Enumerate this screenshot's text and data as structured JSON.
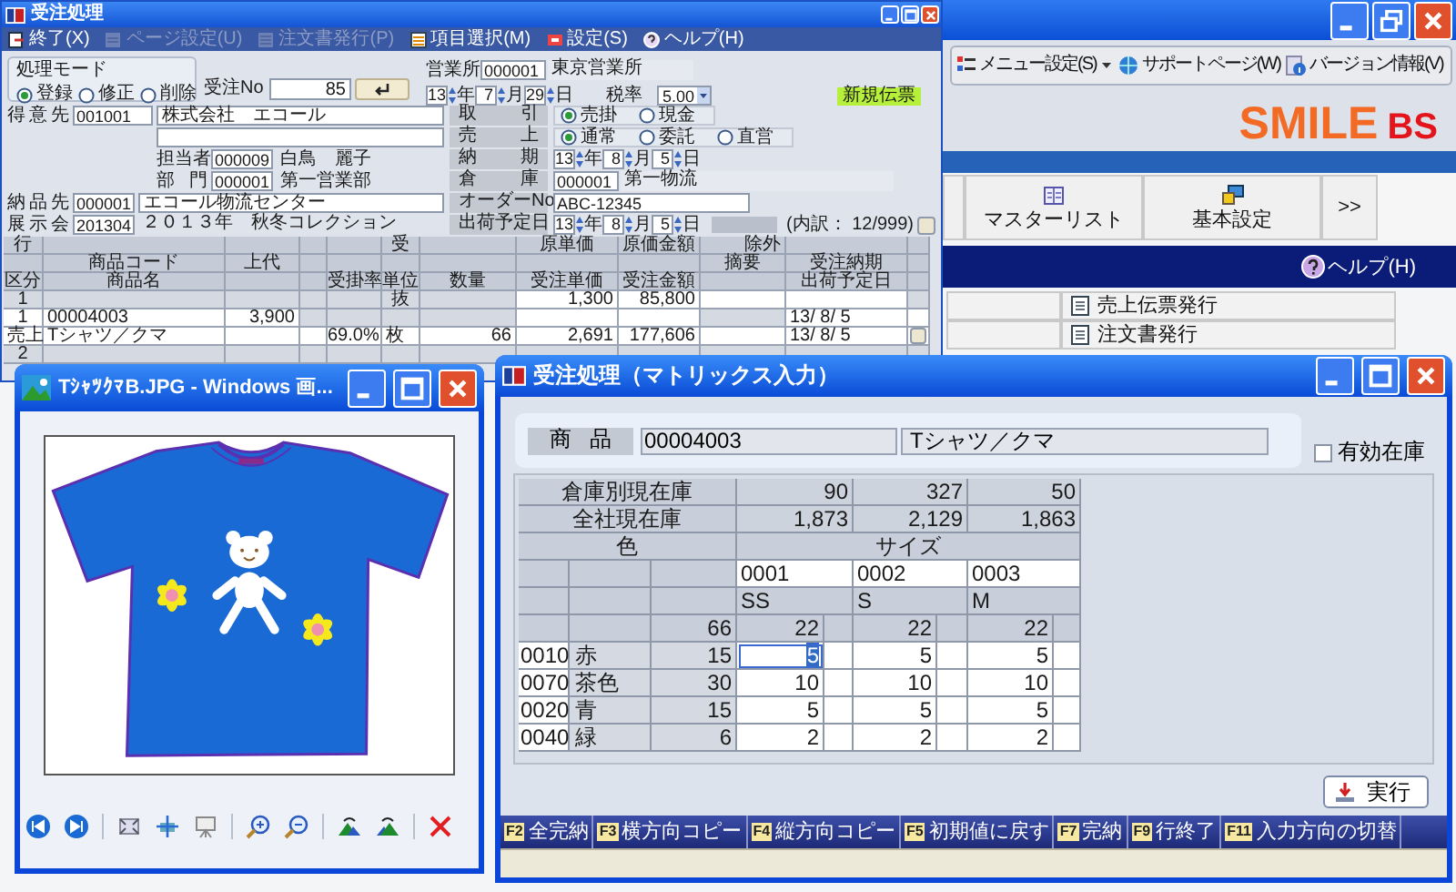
{
  "app": {
    "toolbar": [
      {
        "kind": "menu",
        "label": "メニュー設定(S)",
        "has_menu": true
      },
      {
        "kind": "support",
        "label": "サポートページ(W)",
        "has_menu": false
      },
      {
        "kind": "info",
        "label": "バージョン情報(V)",
        "has_menu": false
      }
    ],
    "logo": {
      "name": "SMILE",
      "suffix": "BS"
    },
    "nav_buttons": [
      {
        "kind": "list",
        "label": "マスターリスト"
      },
      {
        "kind": "settings",
        "label": "基本設定"
      },
      {
        "kind": "more",
        "label": ">>"
      }
    ],
    "help": "ヘルプ(H)",
    "menu_items": [
      "売上伝票発行",
      "注文書発行"
    ]
  },
  "order_window": {
    "title": "受注処理",
    "menu": [
      {
        "kind": "exit",
        "label": "終了(X)",
        "disabled": false
      },
      {
        "kind": "page",
        "label": "ページ設定(U)",
        "disabled": true
      },
      {
        "kind": "document",
        "label": "注文書発行(P)",
        "disabled": true
      },
      {
        "kind": "list",
        "label": "項目選択(M)",
        "disabled": false
      },
      {
        "kind": "settings",
        "label": "設定(S)",
        "disabled": false
      },
      {
        "kind": "help",
        "label": "ヘルプ(H)",
        "disabled": false
      }
    ],
    "mode": {
      "label": "処理モード",
      "options": [
        {
          "label": "登録",
          "selected": true
        },
        {
          "label": "修正",
          "selected": false
        },
        {
          "label": "削除",
          "selected": false
        }
      ]
    },
    "order_no": {
      "label": "受注No",
      "value": "85"
    },
    "office": {
      "label": "営業所",
      "code": "000001",
      "name": "東京営業所"
    },
    "order_date": [
      {
        "value": "13",
        "unit": "年"
      },
      {
        "value": "7",
        "unit": "月"
      },
      {
        "value": "29",
        "unit": "日"
      }
    ],
    "tax": {
      "label": "税率",
      "value": "5.00"
    },
    "badge": "新規伝票",
    "left_rows": [
      {
        "kind": "wide",
        "label": "得意先",
        "code": "001001",
        "name": "株式会社　エコール"
      },
      {
        "kind": "blank"
      },
      {
        "kind": "sub",
        "label": "担当者",
        "code": "000009",
        "name": "白鳥　麗子"
      },
      {
        "kind": "sub",
        "label": "部門",
        "code": "000001",
        "name": "第一営業部"
      },
      {
        "kind": "narrow",
        "label": "納品先",
        "code": "000001",
        "name": "エコール物流センター",
        "name_box": true
      },
      {
        "kind": "narrow",
        "label": "展示会",
        "code": "201304",
        "name": "２０１３年　秋冬コレクション",
        "name_box": false
      }
    ],
    "right_rows": [
      {
        "kind": "radio",
        "label": "取引",
        "options": [
          {
            "label": "売掛",
            "selected": true
          },
          {
            "label": "現金",
            "selected": false
          }
        ]
      },
      {
        "kind": "radio",
        "label": "売上",
        "options": [
          {
            "label": "通常",
            "selected": true
          },
          {
            "label": "委託",
            "selected": false
          },
          {
            "label": "直営",
            "selected": false
          }
        ]
      },
      {
        "kind": "date",
        "label": "納期",
        "parts": [
          {
            "value": "13",
            "unit": "年"
          },
          {
            "value": "8",
            "unit": "月"
          },
          {
            "value": "5",
            "unit": "日"
          }
        ]
      },
      {
        "kind": "code",
        "label": "倉庫",
        "code": "000001",
        "name": "第一物流"
      },
      {
        "kind": "text",
        "label": "オーダーNo",
        "value": "ABC-12345"
      },
      {
        "kind": "date",
        "label": "出荷予定日",
        "parts": [
          {
            "value": "13",
            "unit": "年"
          },
          {
            "value": "8",
            "unit": "月"
          },
          {
            "value": "5",
            "unit": "日"
          }
        ],
        "summary": "(内訳： 12/999)"
      }
    ],
    "grid": {
      "header": [
        [
          {
            "text": "行",
            "kind": "head"
          },
          {
            "kind": "head"
          },
          {
            "kind": "head"
          },
          {
            "kind": "head"
          },
          {
            "kind": "head"
          },
          {
            "text": "受",
            "kind": "head"
          },
          {
            "kind": "head"
          },
          {
            "text": "原単価",
            "kind": "head"
          },
          {
            "text": "原価金額",
            "kind": "head"
          },
          {
            "text": "除外",
            "kind": "head_right"
          },
          {
            "kind": "head"
          },
          {
            "kind": "head"
          }
        ],
        [
          {
            "kind": "head"
          },
          {
            "text": "商品コード",
            "kind": "head"
          },
          {
            "text": "上代",
            "kind": "head"
          },
          {
            "kind": "head"
          },
          {
            "kind": "head"
          },
          {
            "kind": "head"
          },
          {
            "kind": "head"
          },
          {
            "kind": "head"
          },
          {
            "kind": "head"
          },
          {
            "text": "摘要",
            "kind": "head"
          },
          {
            "text": "受注納期",
            "kind": "head"
          },
          {
            "kind": "head"
          }
        ],
        [
          {
            "text": "区分",
            "kind": "head"
          },
          {
            "text": "商品名",
            "kind": "head"
          },
          {
            "kind": "head"
          },
          {
            "kind": "head"
          },
          {
            "text": "受掛率",
            "kind": "head"
          },
          {
            "text": "単位",
            "kind": "head"
          },
          {
            "text": "数量",
            "kind": "head"
          },
          {
            "text": "受注単価",
            "kind": "head"
          },
          {
            "text": "受注金額",
            "kind": "head"
          },
          {
            "kind": "head"
          },
          {
            "text": "出荷予定日",
            "kind": "head"
          },
          {
            "kind": "head"
          }
        ]
      ],
      "rows": [
        [
          {
            "text": "1",
            "kind": "index"
          },
          {
            "kind": "gray"
          },
          {
            "kind": "gray"
          },
          {
            "kind": "gray"
          },
          {
            "kind": "gray"
          },
          {
            "text": "抜",
            "kind": "gray"
          },
          {
            "kind": "gray"
          },
          {
            "text": "1,300",
            "kind": "num"
          },
          {
            "text": "85,800",
            "kind": "num"
          },
          {
            "kind": "input"
          },
          {
            "kind": "input"
          },
          {
            "kind": "gray"
          }
        ],
        [
          {
            "text": "1",
            "kind": "index_input"
          },
          {
            "text": "00004003",
            "kind": "input"
          },
          {
            "text": "3,900",
            "kind": "num"
          },
          {
            "kind": "gray"
          },
          {
            "kind": "gray"
          },
          {
            "kind": "gray"
          },
          {
            "kind": "gray"
          },
          {
            "kind": "input"
          },
          {
            "kind": "input"
          },
          {
            "kind": "gray"
          },
          {
            "text": "13/ 8/ 5",
            "kind": "input"
          },
          {
            "kind": "input"
          }
        ],
        [
          {
            "text": "売上",
            "kind": "input"
          },
          {
            "text": "Tシャツ／クマ",
            "kind": "input"
          },
          {
            "kind": "input"
          },
          {
            "kind": "input"
          },
          {
            "text": "69.0%",
            "kind": "num"
          },
          {
            "text": "枚",
            "kind": "input"
          },
          {
            "text": "66",
            "kind": "num"
          },
          {
            "text": "2,691",
            "kind": "num"
          },
          {
            "text": "177,606",
            "kind": "num"
          },
          {
            "kind": "input"
          },
          {
            "text": "13/ 8/ 5",
            "kind": "input"
          },
          {
            "kind": "button"
          }
        ],
        [
          {
            "text": "2",
            "kind": "index"
          },
          {
            "kind": "gray"
          },
          {
            "kind": "gray"
          },
          {
            "kind": "gray"
          },
          {
            "kind": "gray"
          },
          {
            "kind": "gray"
          },
          {
            "kind": "gray"
          },
          {
            "kind": "gray"
          },
          {
            "kind": "gray"
          },
          {
            "kind": "gray"
          },
          {
            "kind": "gray"
          },
          {
            "kind": "gray"
          }
        ]
      ]
    }
  },
  "image_viewer": {
    "title": "TｼｬﾂｸﾏB.JPG - Windows 画..."
  },
  "matrix_window": {
    "title": "受注処理（マトリックス入力）",
    "product": {
      "label": "商品",
      "code": "00004003",
      "name": "Tシャツ／クマ"
    },
    "stock_option": {
      "label": "有効在庫",
      "checked": false
    },
    "table": {
      "stock_rows": [
        {
          "label": "倉庫別現在庫",
          "values": [
            "90",
            "327",
            "50"
          ]
        },
        {
          "label": "全社現在庫",
          "values": [
            "1,873",
            "2,129",
            "1,863"
          ]
        }
      ],
      "color_header": "色",
      "size_header": "サイズ",
      "total": "66",
      "sizes": [
        {
          "code": "0001",
          "name": "SS",
          "total": "22"
        },
        {
          "code": "0002",
          "name": "S",
          "total": "22"
        },
        {
          "code": "0003",
          "name": "M",
          "total": "22"
        }
      ],
      "colors": [
        {
          "code": "0010",
          "name": "赤",
          "total": "15",
          "quantities": [
            {
              "value": "5",
              "selected": true
            },
            {
              "value": "5",
              "selected": false
            },
            {
              "value": "5",
              "selected": false
            }
          ]
        },
        {
          "code": "0070",
          "name": "茶色",
          "total": "30",
          "quantities": [
            {
              "value": "10",
              "selected": false
            },
            {
              "value": "10",
              "selected": false
            },
            {
              "value": "10",
              "selected": false
            }
          ]
        },
        {
          "code": "0020",
          "name": "青",
          "total": "15",
          "quantities": [
            {
              "value": "5",
              "selected": false
            },
            {
              "value": "5",
              "selected": false
            },
            {
              "value": "5",
              "selected": false
            }
          ]
        },
        {
          "code": "0040",
          "name": "緑",
          "total": "6",
          "quantities": [
            {
              "value": "2",
              "selected": false
            },
            {
              "value": "2",
              "selected": false
            },
            {
              "value": "2",
              "selected": false
            }
          ]
        }
      ]
    },
    "run_button": "実行",
    "function_keys": [
      {
        "key": "F2",
        "label": "全完納"
      },
      {
        "key": "F3",
        "label": "横方向コピー"
      },
      {
        "key": "F4",
        "label": "縦方向コピー"
      },
      {
        "key": "F5",
        "label": "初期値に戻す"
      },
      {
        "key": "F7",
        "label": "完納"
      },
      {
        "key": "F9",
        "label": "行終了"
      },
      {
        "key": "F11",
        "label": "入力方向の切替"
      }
    ]
  }
}
